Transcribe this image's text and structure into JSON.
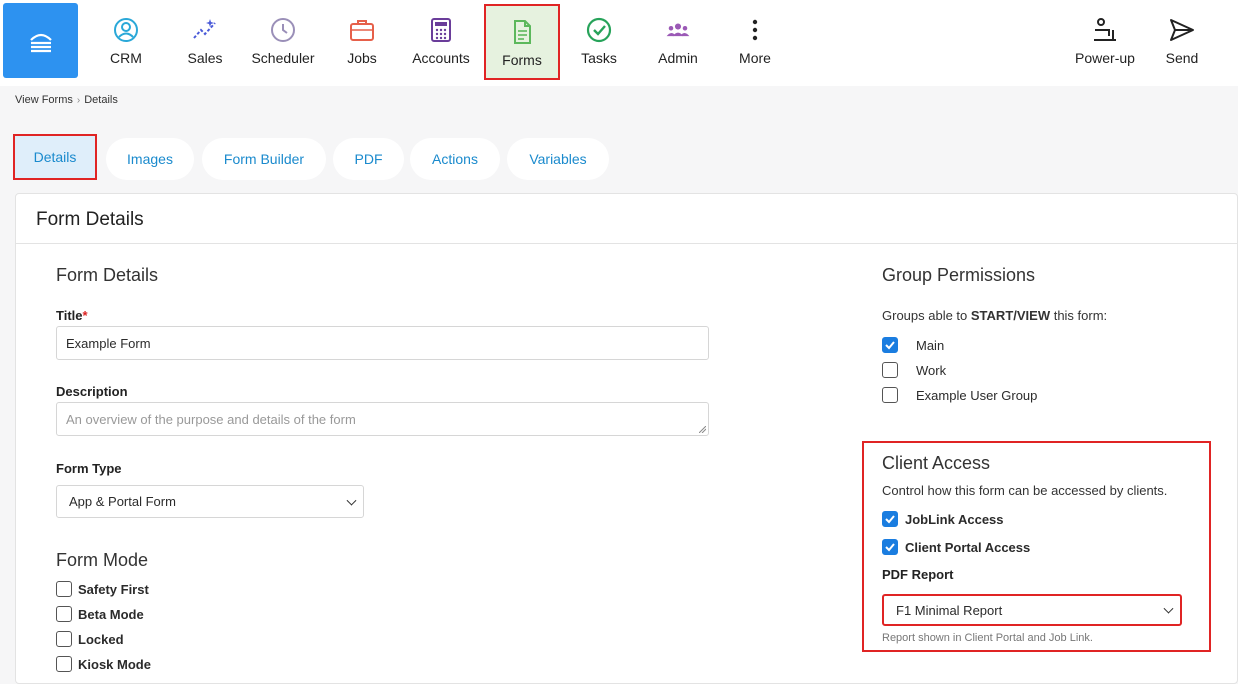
{
  "nav": {
    "items": [
      {
        "label": "CRM",
        "icon": "user-circle-icon"
      },
      {
        "label": "Sales",
        "icon": "sparkle-chart-icon"
      },
      {
        "label": "Scheduler",
        "icon": "clock-icon"
      },
      {
        "label": "Jobs",
        "icon": "briefcase-icon"
      },
      {
        "label": "Accounts",
        "icon": "calculator-icon"
      },
      {
        "label": "Forms",
        "icon": "document-icon"
      },
      {
        "label": "Tasks",
        "icon": "check-circle-icon"
      },
      {
        "label": "Admin",
        "icon": "group-icon"
      },
      {
        "label": "More",
        "icon": "more-vertical-icon"
      }
    ],
    "right": [
      {
        "label": "Power-up",
        "icon": "power-up-icon"
      },
      {
        "label": "Send",
        "icon": "send-icon"
      }
    ],
    "active": "Forms"
  },
  "breadcrumb": {
    "parent": "View Forms",
    "separator": "›",
    "current": "Details"
  },
  "tabs": [
    "Details",
    "Images",
    "Form Builder",
    "PDF",
    "Actions",
    "Variables"
  ],
  "card": {
    "title": "Form Details"
  },
  "form": {
    "section_title": "Form Details",
    "title_label": "Title",
    "required_mark": "*",
    "title_value": "Example Form",
    "description_label": "Description",
    "description_placeholder": "An overview of the purpose and details of the form",
    "form_type_label": "Form Type",
    "form_type_value": "App & Portal Form",
    "mode_title": "Form Mode",
    "modes": [
      {
        "label": "Safety First",
        "checked": false
      },
      {
        "label": "Beta Mode",
        "checked": false
      },
      {
        "label": "Locked",
        "checked": false
      },
      {
        "label": "Kiosk Mode",
        "checked": false
      }
    ]
  },
  "permissions": {
    "title": "Group Permissions",
    "intro_prefix": "Groups able to ",
    "intro_strong": "START/VIEW",
    "intro_suffix": " this form:",
    "groups": [
      {
        "label": "Main",
        "checked": true
      },
      {
        "label": "Work",
        "checked": false
      },
      {
        "label": "Example User Group",
        "checked": false
      }
    ]
  },
  "client_access": {
    "title": "Client Access",
    "description": "Control how this form can be accessed by clients.",
    "options": [
      {
        "label": "JobLink Access",
        "checked": true
      },
      {
        "label": "Client Portal Access",
        "checked": true
      }
    ],
    "pdf_label": "PDF Report",
    "pdf_value": "F1 Minimal Report",
    "pdf_help": "Report shown in Client Portal and Job Link."
  },
  "colors": {
    "accent": "#1a8acd",
    "logo": "#2d92f0",
    "highlight": "#e02424",
    "checkbox": "#1a7de0"
  }
}
